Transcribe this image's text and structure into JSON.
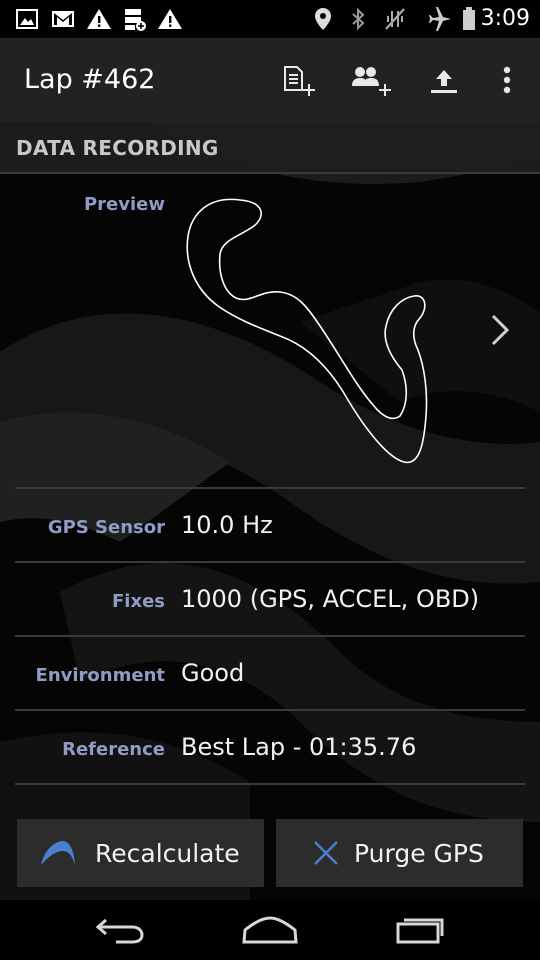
{
  "status_bar": {
    "time": "3:09",
    "icons": [
      "image-icon",
      "gmail-icon",
      "warning-icon",
      "sd-card-icon",
      "warning-icon",
      "location-icon",
      "bluetooth-icon",
      "vibrate-off-icon",
      "airplane-mode-icon",
      "battery-icon"
    ]
  },
  "action_bar": {
    "title": "Lap #462",
    "actions": [
      "add-document-icon",
      "add-group-icon",
      "upload-icon",
      "overflow-menu-icon"
    ]
  },
  "section": {
    "title": "DATA RECORDING"
  },
  "preview": {
    "label": "Preview",
    "next_icon": "chevron-right-icon"
  },
  "rows": [
    {
      "label": "GPS Sensor",
      "value": "10.0 Hz"
    },
    {
      "label": "Fixes",
      "value": "1000 (GPS, ACCEL, OBD)"
    },
    {
      "label": "Environment",
      "value": "Good"
    },
    {
      "label": "Reference",
      "value": "Best Lap - 01:35.76"
    }
  ],
  "buttons": {
    "recalculate": {
      "label": "Recalculate",
      "icon": "recalculate-arc-icon"
    },
    "purge": {
      "label": "Purge GPS",
      "icon": "close-icon"
    }
  },
  "nav_bar": {
    "icons": [
      "back-icon",
      "home-icon",
      "recents-icon"
    ]
  },
  "colors": {
    "label_blue": "#8f9cc4",
    "accent_blue": "#4a7fd0",
    "button_bg": "#2c2c2c",
    "action_bar_bg": "#222222"
  }
}
